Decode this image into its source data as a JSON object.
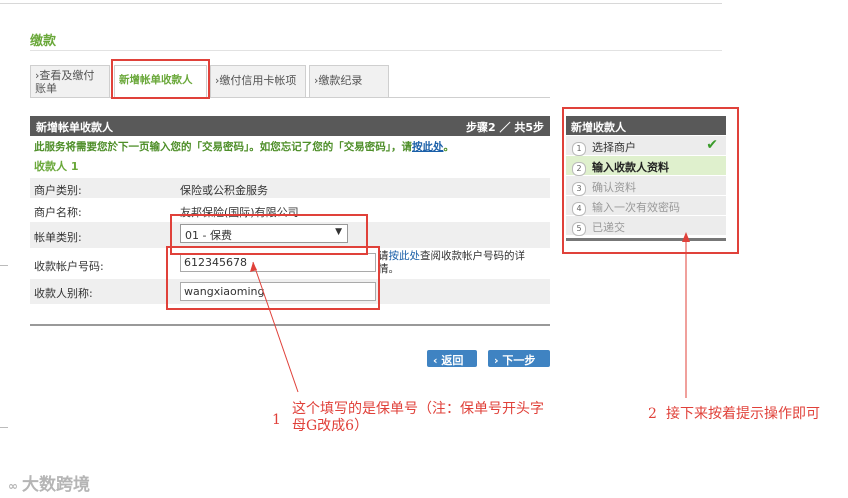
{
  "page": {
    "title": "缴款"
  },
  "tabs": [
    {
      "label": "›查看及缴付账单"
    },
    {
      "label": "新增帐单收款人"
    },
    {
      "label": "›缴付信用卡帐项"
    },
    {
      "label": "›缴款纪录"
    }
  ],
  "panel": {
    "title": "新增帐单收款人",
    "steps": "步骤2 ／ 共5步",
    "notice": "此服务将需要您於下一页输入您的「交易密码」。如您忘记了您的「交易密码」，请",
    "notice_link": "按此处",
    "notice_end": "。",
    "payee_heading": "收款人 1",
    "merchant_type_label": "商户类别:",
    "merchant_type_value": "保险或公积金服务",
    "merchant_name_label": "商户名称:",
    "merchant_name_value": "友邦保险(国际)有限公司",
    "account_type_label": "帐单类别:",
    "account_type_value": "01 - 保费",
    "account_number_label": "收款帐户号码:",
    "account_number_value": "612345678",
    "hint_prefix": "请",
    "hint_link": "按此处",
    "hint_suffix": "查阅收款帐户号码的详情。",
    "nickname_label": "收款人别称:",
    "nickname_value": "wangxiaoming"
  },
  "buttons": {
    "back": "‹ 返回",
    "next": "› 下一步"
  },
  "sidebar": {
    "title": "新增收款人",
    "items": [
      {
        "num": "1",
        "label": "选择商户"
      },
      {
        "num": "2",
        "label": "输入收款人资料"
      },
      {
        "num": "3",
        "label": "确认资料"
      },
      {
        "num": "4",
        "label": "输入一次有效密码"
      },
      {
        "num": "5",
        "label": "已递交"
      }
    ],
    "check": "✔"
  },
  "annotations": {
    "note1_num": "1",
    "note1_text": "这个填写的是保单号（注：保单号开头字母G改成6）",
    "note2_num": "2",
    "note2_text": "接下来按着提示操作即可"
  },
  "watermark": "大数跨境",
  "colors": {
    "accent_green": "#6aa83a",
    "header_gray": "#595959",
    "annotation_red": "#e0413a",
    "button_blue": "#3f83c2"
  }
}
